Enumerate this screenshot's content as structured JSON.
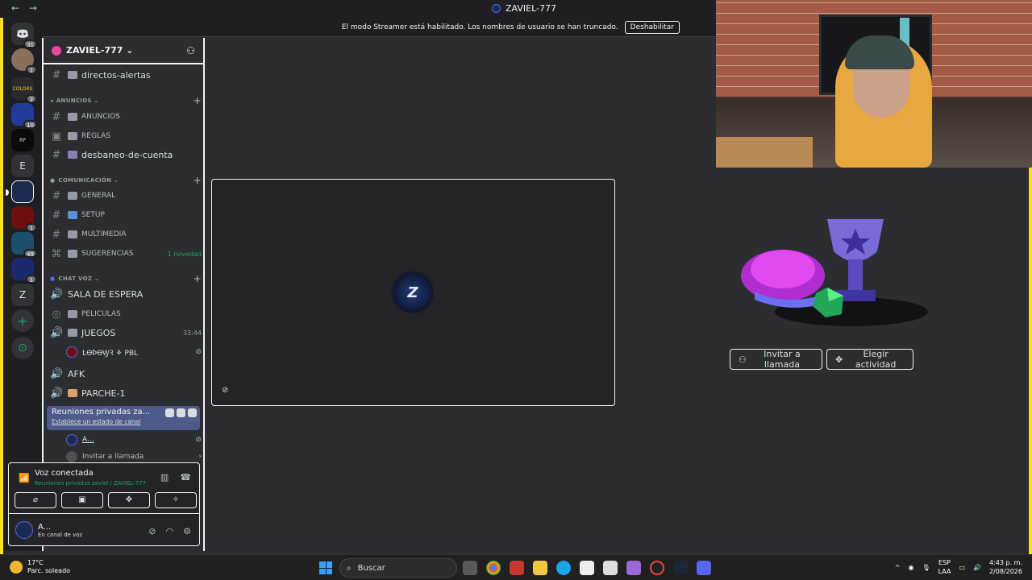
{
  "titlebar": {
    "back": "←",
    "forward": "→",
    "title": "ZAVIEL-777"
  },
  "banner": {
    "text": "El modo Streamer está habilitado. Los nombres de usuario se han truncado.",
    "button": "Deshabilitar"
  },
  "guilds": [
    {
      "label": "",
      "badge": "31",
      "icon": "discord-icon"
    },
    {
      "label": "",
      "badge": "1",
      "icon": "avatar"
    },
    {
      "label": "",
      "badge": "2",
      "icon": "server-colors"
    },
    {
      "label": "",
      "badge": "10",
      "icon": "server-blue"
    },
    {
      "label": "",
      "badge": "",
      "icon": "server-roleplay"
    },
    {
      "label": "E",
      "badge": "",
      "icon": "server-e"
    },
    {
      "label": "",
      "badge": "",
      "icon": "server-zaviel"
    },
    {
      "label": "",
      "badge": "1",
      "icon": "server-red"
    },
    {
      "label": "",
      "badge": "49",
      "icon": "server-teal"
    },
    {
      "label": "",
      "badge": "1",
      "icon": "server-w"
    },
    {
      "label": "Z",
      "badge": "",
      "icon": "server-z"
    },
    {
      "label": "+",
      "badge": "",
      "icon": "add-server-icon"
    },
    {
      "label": "⊙",
      "badge": "",
      "icon": "explore-icon"
    }
  ],
  "server": {
    "name": "ZAVIEL-777 ⌄"
  },
  "channels": {
    "directos": "directos-alertas",
    "cat_anuncios": "ANUNCIOS ⌄",
    "anuncios": "ANUNCIOS",
    "reglas": "REGLAS",
    "desbaneo": "desbaneo-de-cuenta",
    "cat_comunicacion": "COMUNICACIÓN ⌄",
    "general": "GENERAL",
    "setup": "SETUP",
    "multimedia": "MULTIMEDIA",
    "sugerencias": "SUGERENCIAS",
    "sugerencias_badge": "1 novedad",
    "cat_chatvoz": "CHAT VOZ ⌄",
    "sala": "SALA DE ESPERA",
    "peliculas": "PELICULAS",
    "juegos": "JUEGOS",
    "juegos_time": "33:44",
    "juegos_user": "ꝈꝊꝤꝊꝠꝚ ⚘ PBL",
    "afk": "AFK",
    "parche": "PARCHE-1",
    "reuniones": "Reuniones privadas za...",
    "reuniones_status": "Establece un estado de canal",
    "reuniones_user": "A...",
    "invite": "Invitar a llamada"
  },
  "rtc": {
    "title": "Voz conectada",
    "subtitle": "Reuniones privadas zaviel / ZAVIEL-777",
    "username": "A...",
    "user_status": "En canal de voz"
  },
  "tile": {
    "logo_text": "Z",
    "mute_icon": "mic-off-icon"
  },
  "actions": {
    "invite": "Invitar a llamada",
    "activity": "Elegir actividad"
  },
  "taskbar": {
    "temp": "17°C",
    "weather": "Parc. soleado",
    "search": "Buscar",
    "lang1": "ESP",
    "lang2": "LAA",
    "time": "4:43 p. m.",
    "date": "2/08/2026"
  }
}
